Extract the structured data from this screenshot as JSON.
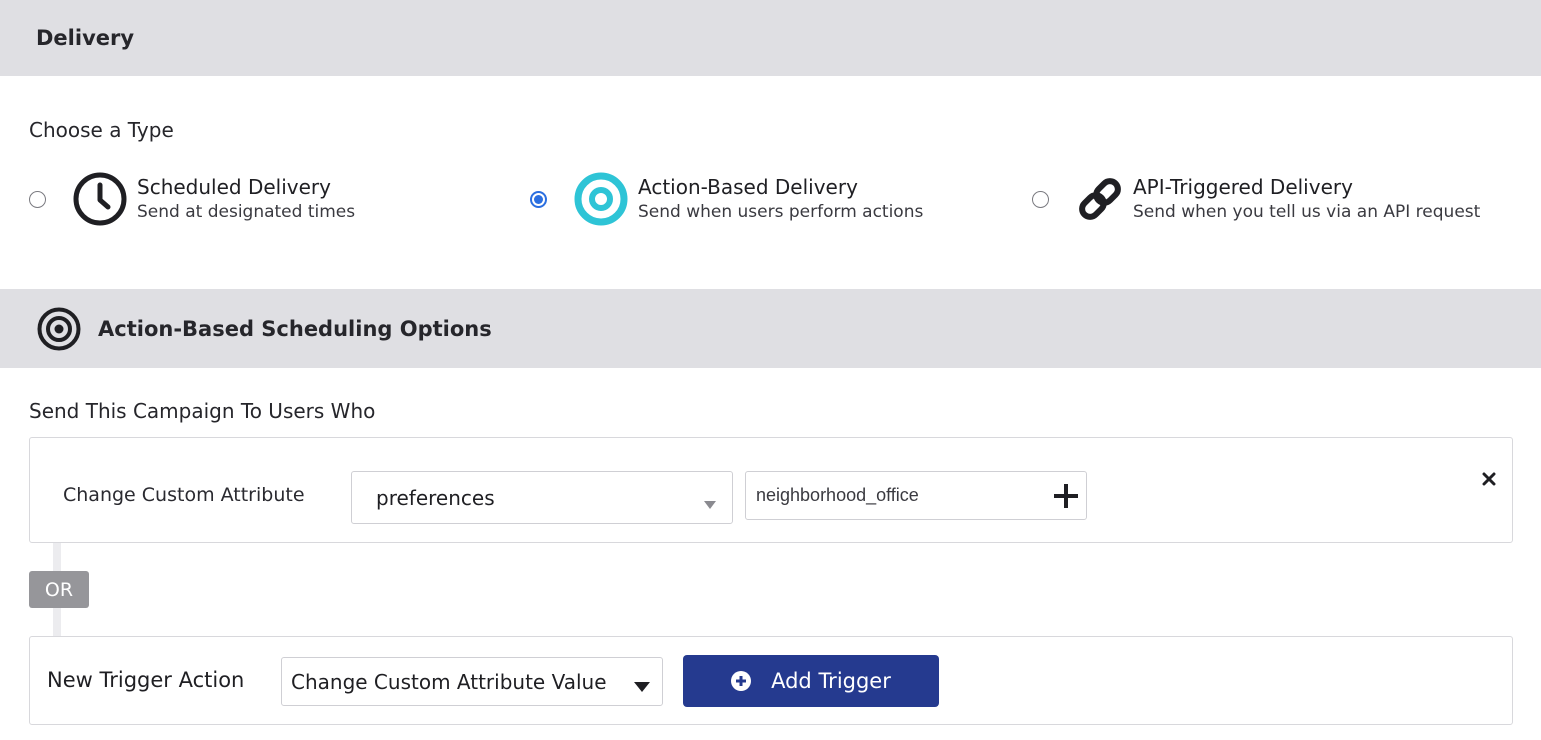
{
  "delivery": {
    "title": "Delivery",
    "choose_label": "Choose a Type",
    "types": [
      {
        "title": "Scheduled Delivery",
        "description": "Send at designated times",
        "icon": "clock-icon",
        "selected": false
      },
      {
        "title": "Action-Based Delivery",
        "description": "Send when users perform actions",
        "icon": "target-icon",
        "selected": true
      },
      {
        "title": "API-Triggered Delivery",
        "description": "Send when you tell us via an API request",
        "icon": "link-icon",
        "selected": false
      }
    ]
  },
  "scheduling": {
    "title": "Action-Based Scheduling Options",
    "icon": "target-icon",
    "send_label": "Send This Campaign To Users Who",
    "trigger": {
      "action_label": "Change Custom Attribute",
      "attribute_value": "preferences",
      "value_input": "neighborhood_office"
    },
    "or_label": "OR",
    "new_trigger": {
      "label": "New Trigger Action",
      "selected_action": "Change Custom Attribute Value",
      "add_button_label": "Add Trigger"
    }
  },
  "colors": {
    "accent": "#2b6fe0",
    "button": "#253a8f",
    "target_icon": "#2ec4d6",
    "section_bar": "#dfdfe3"
  }
}
